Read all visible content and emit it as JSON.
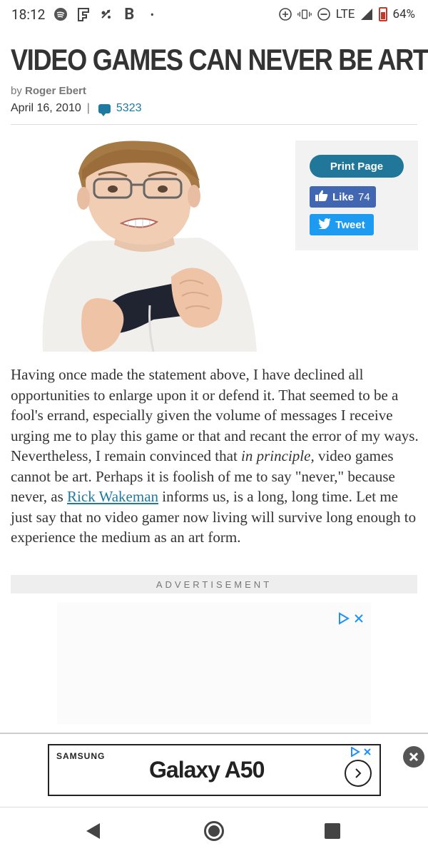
{
  "status_bar": {
    "time": "18:12",
    "lte_label": "LTE",
    "battery": "64%",
    "icons": [
      "spotify-icon",
      "flipboard-icon",
      "bitmoji-icon",
      "bold-b-icon",
      "dot-icon",
      "location-plus-icon",
      "vibrate-icon",
      "do-not-disturb-icon",
      "signal-icon",
      "battery-icon"
    ]
  },
  "article": {
    "title": "VIDEO GAMES CAN NEVER BE ART",
    "byline_prefix": "by",
    "author": "Roger Ebert",
    "date": "April 16, 2010",
    "separator": "|",
    "comment_count": "5323",
    "body_parts": {
      "p1": "Having once made the statement above, I have declined all opportunities to enlarge upon it or defend it. That seemed to be a fool's errand, especially given the volume of messages I receive urging me to play this game or that and recant the error of my ways. Nevertheless, I remain convinced that ",
      "em": "in principle,",
      "p2": " video games cannot be art. Perhaps it is foolish of me to say \"never,\" because never, as ",
      "link": "Rick Wakeman",
      "p3": " informs us, is a long, long time. Let me just say that no video gamer now living will survive long enough to experience the medium as an art form."
    }
  },
  "share": {
    "print_label": "Print Page",
    "like_label": "Like",
    "like_count": "74",
    "tweet_label": "Tweet"
  },
  "ads": {
    "label": "ADVERTISEMENT",
    "banner_brand": "SAMSUNG",
    "banner_model": "Galaxy A50"
  },
  "colors": {
    "accent": "#207799",
    "facebook": "#4267b2",
    "twitter": "#1d9bf0"
  }
}
